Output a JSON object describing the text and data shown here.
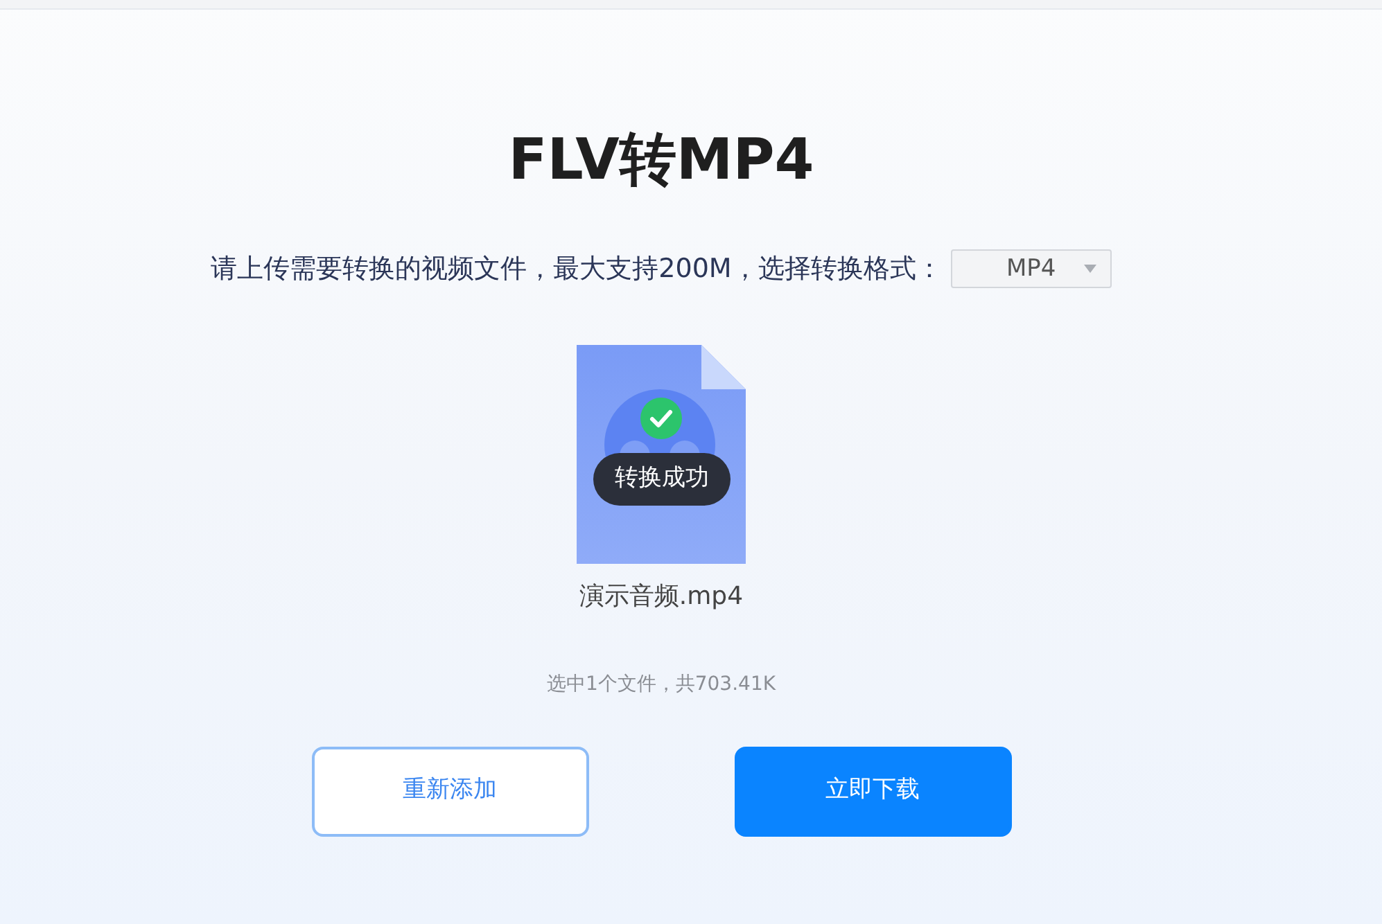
{
  "page": {
    "title": "FLV转MP4"
  },
  "upload_prompt": {
    "text": "请上传需要转换的视频文件，最大支持200M，选择转换格式：",
    "format_select": {
      "value": "MP4"
    }
  },
  "file": {
    "name": "演示音频.mp4",
    "status_badge": "转换成功",
    "converted": true
  },
  "selection_summary": "选中1个文件，共703.41K",
  "buttons": [
    {
      "label": "重新添加",
      "kind": "outline"
    },
    {
      "label": "立即下载",
      "kind": "primary"
    }
  ]
}
